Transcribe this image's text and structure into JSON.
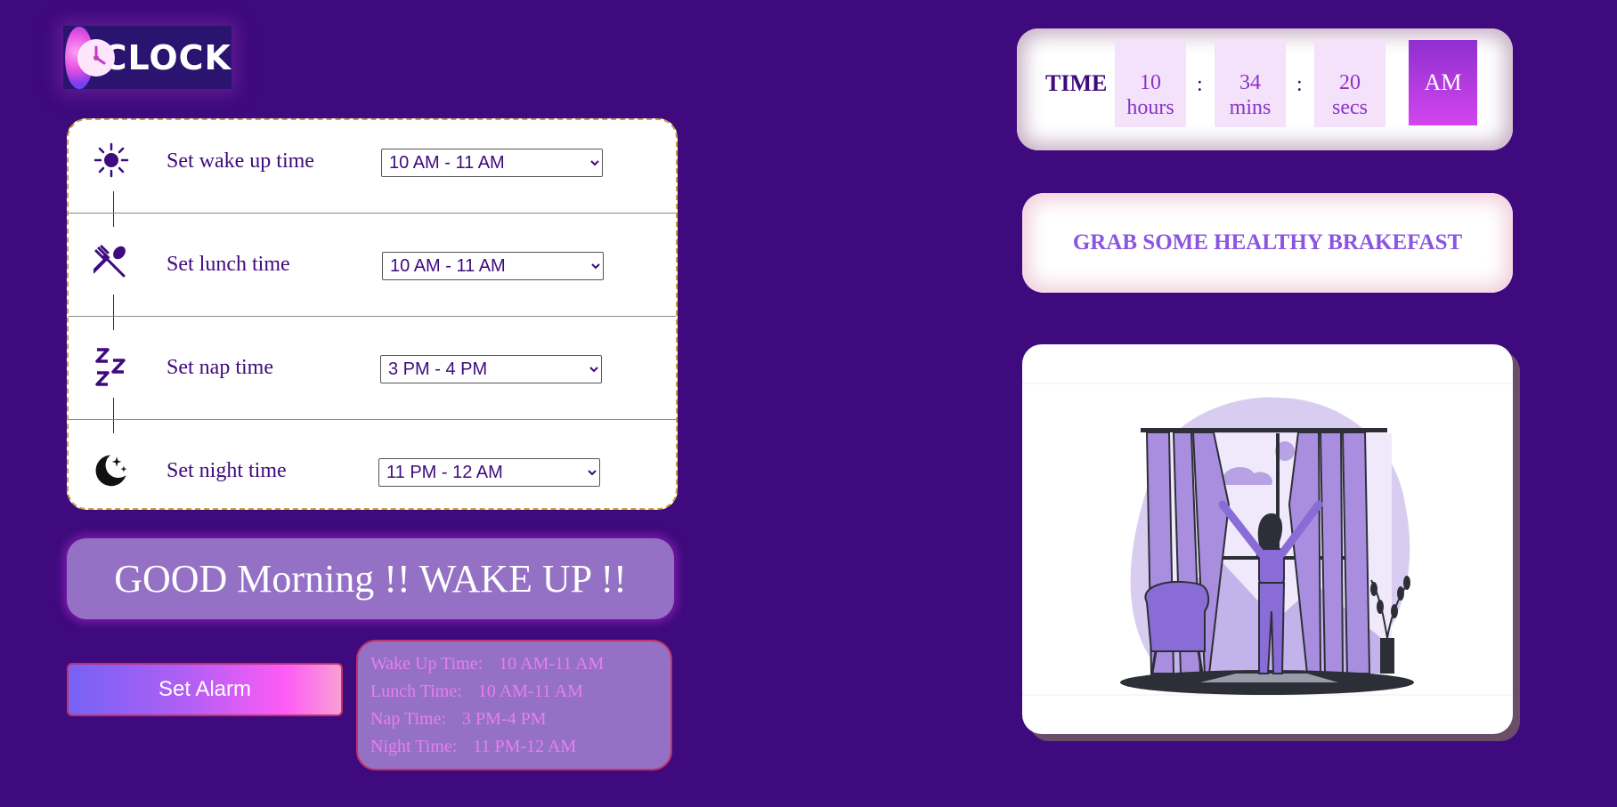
{
  "logo": {
    "text": "CLOCK",
    "icon": "clock-icon"
  },
  "schedule": {
    "rows": [
      {
        "icon": "sun-icon",
        "label": "Set wake up time",
        "selected": "10 AM - 11 AM"
      },
      {
        "icon": "fork-spoon-icon",
        "label": "Set lunch time",
        "selected": "10 AM - 11 AM"
      },
      {
        "icon": "sleep-zzz-icon",
        "label": "Set nap time",
        "selected": "3 PM - 4 PM"
      },
      {
        "icon": "moon-stars-icon",
        "label": "Set night time",
        "selected": "11 PM - 12 AM"
      }
    ]
  },
  "greeting": "GOOD Morning !! WAKE UP !!",
  "set_alarm_label": "Set Alarm",
  "summary": {
    "wake": {
      "label": "Wake Up Time:",
      "value": "10 AM-11 AM"
    },
    "lunch": {
      "label": "Lunch Time:",
      "value": "10 AM-11 AM"
    },
    "nap": {
      "label": "Nap Time:",
      "value": "3 PM-4 PM"
    },
    "night": {
      "label": "Night Time:",
      "value": "11 PM-12 AM"
    }
  },
  "time": {
    "label": "TIME",
    "hours": "10",
    "hours_unit": "hours",
    "mins": "34",
    "mins_unit": "mins",
    "secs": "20",
    "secs_unit": "secs",
    "separator": ":",
    "ampm": "AM"
  },
  "advice": "GRAB SOME HEALTHY BRAKEFAST",
  "illustration": {
    "icon": "woman-opening-curtains-illustration"
  },
  "colors": {
    "background": "#3e0a7d",
    "accent": "#8a55e0",
    "panel": "#9471c4"
  }
}
